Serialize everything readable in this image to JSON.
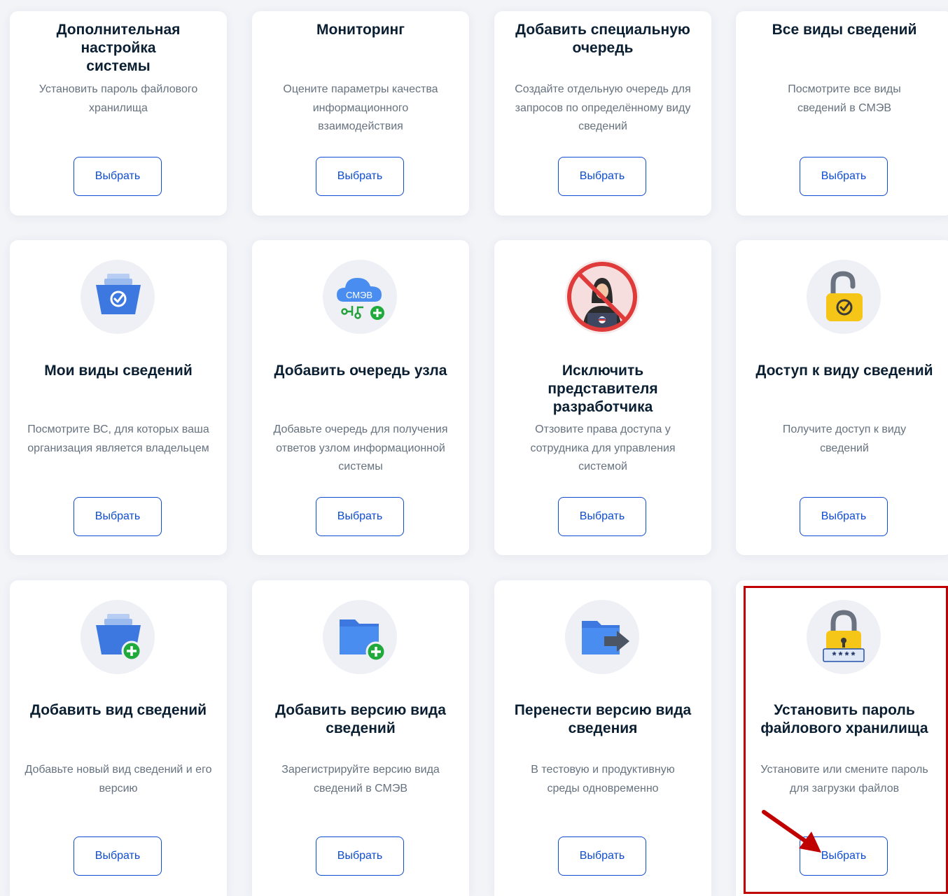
{
  "button_label": "Выбрать",
  "colors": {
    "accent": "#0d4cd3",
    "highlight": "#c00000",
    "page_bg": "#f3f4f8"
  },
  "rows": [
    {
      "cards": [
        {
          "title": "Дополнительная настройка системы",
          "description": "Установить пароль файлового хранилища",
          "icon": null
        },
        {
          "title": "Мониторинг",
          "description": "Оцените параметры качества информационного взаимодействия",
          "icon": null
        },
        {
          "title": "Добавить специальную очередь",
          "description": "Создайте отдельную очередь для запросов по определённому виду сведений",
          "icon": null
        },
        {
          "title": "Все виды сведений",
          "description": "Посмотрите все виды сведений в СМЭВ",
          "icon": null
        }
      ]
    },
    {
      "cards": [
        {
          "title": "Мои виды сведений",
          "description": "Посмотрите ВС, для которых ваша организация является владельцем",
          "icon": "folder-check-icon"
        },
        {
          "title": "Добавить очередь узла",
          "description": "Добавьте очередь для получения ответов узлом информационной системы",
          "icon": "smev-cloud-add-icon",
          "icon_text": "СМЭВ"
        },
        {
          "title": "Исключить представителя разработчика",
          "description": "Отзовите права доступа у сотрудника для управления системой",
          "icon": "exclude-person-icon"
        },
        {
          "title": "Доступ к виду сведений",
          "description": "Получите доступ к виду сведений",
          "icon": "open-lock-check-icon"
        }
      ]
    },
    {
      "cards": [
        {
          "title": "Добавить вид сведений",
          "description": "Добавьте новый вид сведений и его версию",
          "icon": "folder-add-icon"
        },
        {
          "title": "Добавить версию вида сведений",
          "description": "Зарегистрируйте версию вида сведений в СМЭВ",
          "icon": "folder-plus-icon"
        },
        {
          "title": "Перенести версию вида сведения",
          "description": "В тестовую и продуктивную среды одновременно",
          "icon": "folder-move-icon"
        },
        {
          "title": "Установить пароль файлового хранилища",
          "description": "Установите или смените пароль для загрузки файлов",
          "icon": "lock-password-icon",
          "icon_text": "****",
          "highlighted": true
        }
      ]
    }
  ]
}
